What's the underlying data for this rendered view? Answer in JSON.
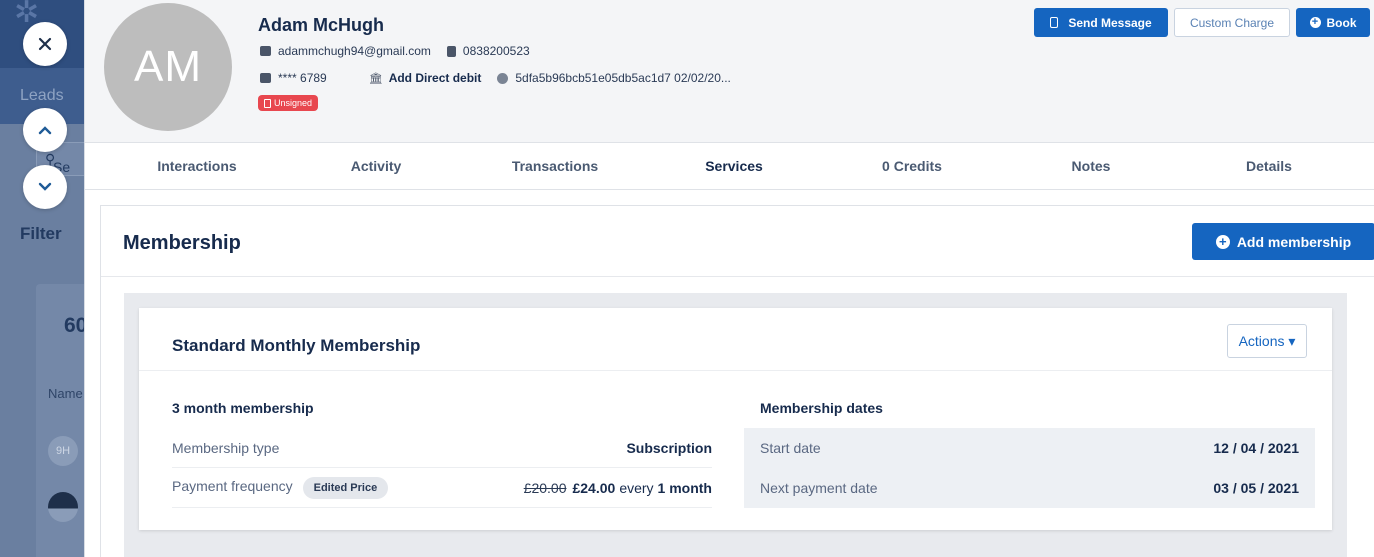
{
  "background_app": {
    "nav_label": "Leads",
    "search_placeholder": "Se",
    "filter_label": "Filter",
    "count": "60",
    "column_label": "Name",
    "avatar_initials": "9H"
  },
  "profile": {
    "initials": "AM",
    "name": "Adam McHugh",
    "email": "adammchugh94@gmail.com",
    "phone": "0838200523",
    "card": "**** 6789",
    "direct_debit": "Add Direct debit",
    "id_info": "5dfa5b96bcb51e05db5ac1d7  02/02/20...",
    "status_badge": "Unsigned"
  },
  "header_actions": {
    "send_message": "Send Message",
    "custom_charge": "Custom Charge",
    "book": "Book"
  },
  "tabs": [
    {
      "label": "Interactions"
    },
    {
      "label": "Activity"
    },
    {
      "label": "Transactions"
    },
    {
      "label": "Services",
      "active": true
    },
    {
      "label": "0 Credits"
    },
    {
      "label": "Notes"
    },
    {
      "label": "Details"
    }
  ],
  "membership": {
    "title": "Membership",
    "add_button": "Add membership",
    "plan_name": "Standard Monthly Membership",
    "actions_label": "Actions ▾",
    "left_heading": "3 month membership",
    "type_label": "Membership type",
    "type_value": "Subscription",
    "frequency_label": "Payment frequency",
    "frequency_badge": "Edited Price",
    "old_price": "£20.00",
    "new_price": "£24.00",
    "every": "every",
    "period": "1 month",
    "right_heading": "Membership dates",
    "start_label": "Start date",
    "start_value": "12 / 04 / 2021",
    "next_label": "Next payment date",
    "next_value": "03 / 05 / 2021"
  },
  "colors": {
    "primary": "#1565c0",
    "danger": "#e8474f",
    "text_dark": "#172b4d"
  }
}
